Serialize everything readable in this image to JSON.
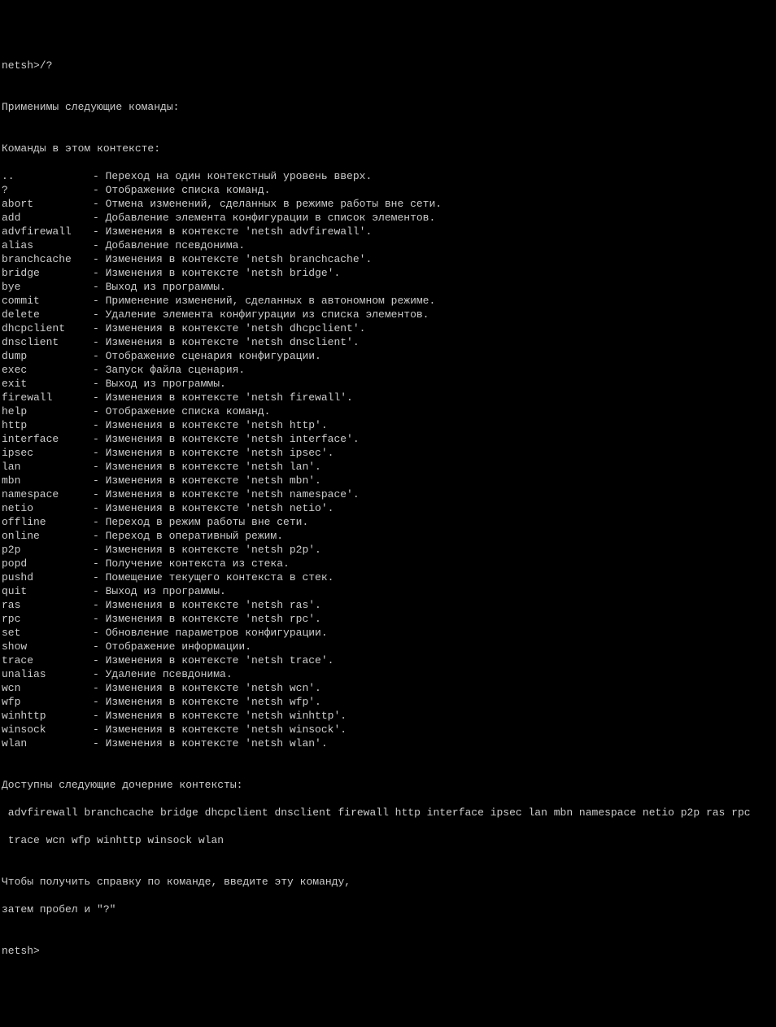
{
  "prompt_line": "netsh>/?",
  "blank": "",
  "intro": "Применимы следующие команды:",
  "section_header": "Команды в этом контексте:",
  "commands": [
    {
      "name": "..",
      "desc": "- Переход на один контекстный уровень вверх."
    },
    {
      "name": "?",
      "desc": "- Отображение списка команд."
    },
    {
      "name": "abort",
      "desc": "- Отмена изменений, сделанных в режиме работы вне сети."
    },
    {
      "name": "add",
      "desc": "- Добавление элемента конфигурации в список элементов."
    },
    {
      "name": "advfirewall",
      "desc": "- Изменения в контексте 'netsh advfirewall'."
    },
    {
      "name": "alias",
      "desc": "- Добавление псевдонима."
    },
    {
      "name": "branchcache",
      "desc": "- Изменения в контексте 'netsh branchcache'."
    },
    {
      "name": "bridge",
      "desc": "- Изменения в контексте 'netsh bridge'."
    },
    {
      "name": "bye",
      "desc": "- Выход из программы."
    },
    {
      "name": "commit",
      "desc": "- Применение изменений, сделанных в автономном режиме."
    },
    {
      "name": "delete",
      "desc": "- Удаление элемента конфигурации из списка элементов."
    },
    {
      "name": "dhcpclient",
      "desc": "- Изменения в контексте 'netsh dhcpclient'."
    },
    {
      "name": "dnsclient",
      "desc": "- Изменения в контексте 'netsh dnsclient'."
    },
    {
      "name": "dump",
      "desc": "- Отображение сценария конфигурации."
    },
    {
      "name": "exec",
      "desc": "- Запуск файла сценария."
    },
    {
      "name": "exit",
      "desc": "- Выход из программы."
    },
    {
      "name": "firewall",
      "desc": "- Изменения в контексте 'netsh firewall'."
    },
    {
      "name": "help",
      "desc": "- Отображение списка команд."
    },
    {
      "name": "http",
      "desc": "- Изменения в контексте 'netsh http'."
    },
    {
      "name": "interface",
      "desc": "- Изменения в контексте 'netsh interface'."
    },
    {
      "name": "ipsec",
      "desc": "- Изменения в контексте 'netsh ipsec'."
    },
    {
      "name": "lan",
      "desc": "- Изменения в контексте 'netsh lan'."
    },
    {
      "name": "mbn",
      "desc": "- Изменения в контексте 'netsh mbn'."
    },
    {
      "name": "namespace",
      "desc": "- Изменения в контексте 'netsh namespace'."
    },
    {
      "name": "netio",
      "desc": "- Изменения в контексте 'netsh netio'."
    },
    {
      "name": "offline",
      "desc": "- Переход в режим работы вне сети."
    },
    {
      "name": "online",
      "desc": "- Переход в оперативный режим."
    },
    {
      "name": "p2p",
      "desc": "- Изменения в контексте 'netsh p2p'."
    },
    {
      "name": "popd",
      "desc": "- Получение контекста из стека."
    },
    {
      "name": "pushd",
      "desc": "- Помещение текущего контекста в стек."
    },
    {
      "name": "quit",
      "desc": "- Выход из программы."
    },
    {
      "name": "ras",
      "desc": "- Изменения в контексте 'netsh ras'."
    },
    {
      "name": "rpc",
      "desc": "- Изменения в контексте 'netsh rpc'."
    },
    {
      "name": "set",
      "desc": "- Обновление параметров конфигурации."
    },
    {
      "name": "show",
      "desc": "- Отображение информации."
    },
    {
      "name": "trace",
      "desc": "- Изменения в контексте 'netsh trace'."
    },
    {
      "name": "unalias",
      "desc": "- Удаление псевдонима."
    },
    {
      "name": "wcn",
      "desc": "- Изменения в контексте 'netsh wcn'."
    },
    {
      "name": "wfp",
      "desc": "- Изменения в контексте 'netsh wfp'."
    },
    {
      "name": "winhttp",
      "desc": "- Изменения в контексте 'netsh winhttp'."
    },
    {
      "name": "winsock",
      "desc": "- Изменения в контексте 'netsh winsock'."
    },
    {
      "name": "wlan",
      "desc": "- Изменения в контексте 'netsh wlan'."
    }
  ],
  "sub_contexts_header": "Доступны следующие дочерние контексты:",
  "sub_contexts_line1": " advfirewall branchcache bridge dhcpclient dnsclient firewall http interface ipsec lan mbn namespace netio p2p ras rpc",
  "sub_contexts_line2": " trace wcn wfp winhttp winsock wlan",
  "help_hint_line1": "Чтобы получить справку по команде, введите эту команду,",
  "help_hint_line2": "затем пробел и \"?\"",
  "final_prompt": "netsh>"
}
